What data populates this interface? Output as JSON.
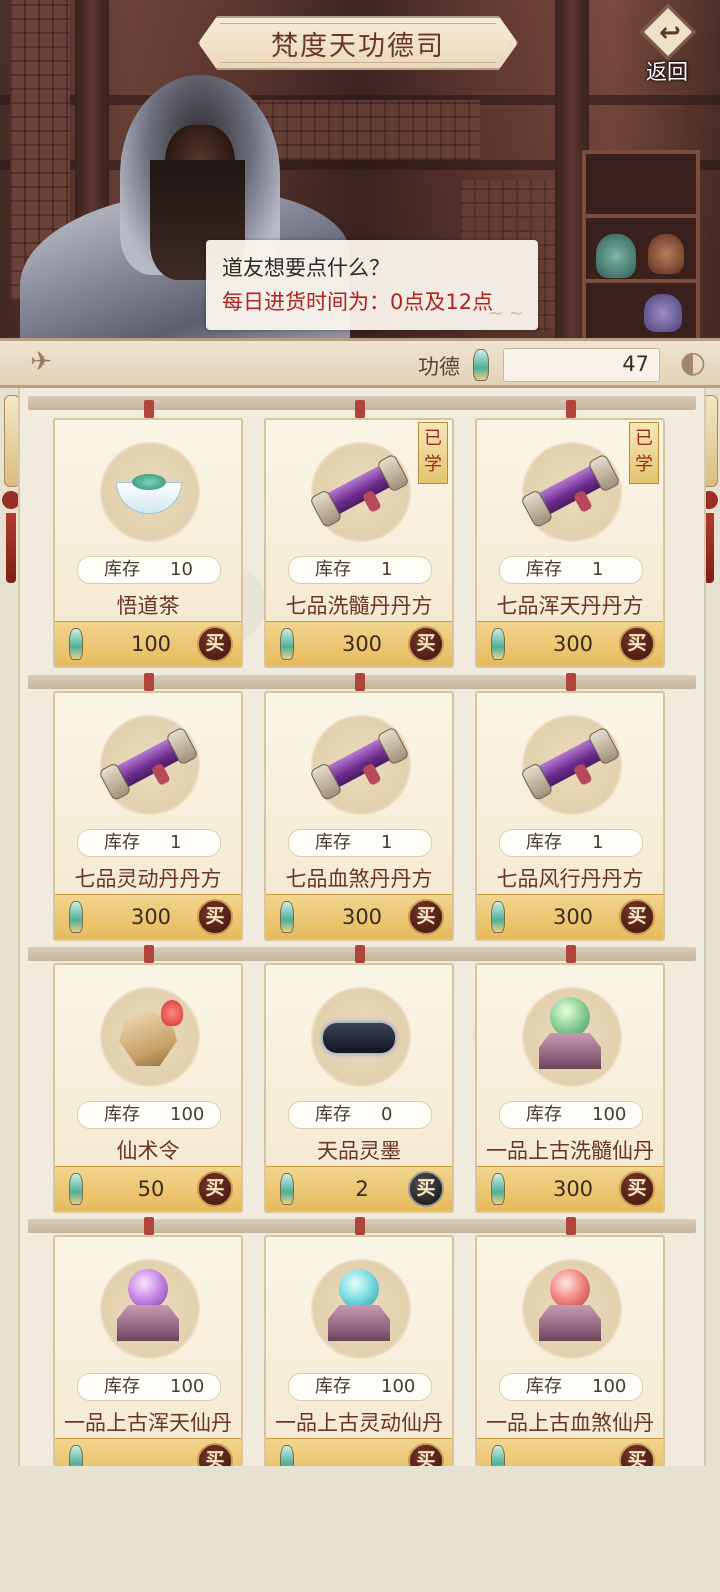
{
  "header": {
    "title": "梵度天功德司",
    "back_label": "返回"
  },
  "dialog": {
    "line1": "道友想要点什么？",
    "line2": "每日进货时间为：0点及12点"
  },
  "merit": {
    "label": "功德",
    "value": "47"
  },
  "shop": {
    "stock_label": "库存",
    "buy_label": "买",
    "learned_label": "已学",
    "items": [
      {
        "name": "悟道茶",
        "stock": "10",
        "price": "100",
        "learned": false,
        "art": "tea"
      },
      {
        "name": "七品洗髓丹丹方",
        "stock": "1",
        "price": "300",
        "learned": true,
        "art": "scroll"
      },
      {
        "name": "七品浑天丹丹方",
        "stock": "1",
        "price": "300",
        "learned": true,
        "art": "scroll"
      },
      {
        "name": "七品灵动丹丹方",
        "stock": "1",
        "price": "300",
        "learned": false,
        "art": "scroll"
      },
      {
        "name": "七品血煞丹丹方",
        "stock": "1",
        "price": "300",
        "learned": false,
        "art": "scroll"
      },
      {
        "name": "七品风行丹丹方",
        "stock": "1",
        "price": "300",
        "learned": false,
        "art": "scroll"
      },
      {
        "name": "仙术令",
        "stock": "100",
        "price": "50",
        "learned": false,
        "art": "token"
      },
      {
        "name": "天品灵墨",
        "stock": "0",
        "price": "2",
        "learned": false,
        "art": "ink"
      },
      {
        "name": "一品上古洗髓仙丹",
        "stock": "100",
        "price": "300",
        "learned": false,
        "art": "pill-green"
      },
      {
        "name": "一品上古浑天仙丹",
        "stock": "100",
        "price": "",
        "learned": false,
        "art": "pill-purple"
      },
      {
        "name": "一品上古灵动仙丹",
        "stock": "100",
        "price": "",
        "learned": false,
        "art": "pill-cyan"
      },
      {
        "name": "一品上古血煞仙丹",
        "stock": "100",
        "price": "",
        "learned": false,
        "art": "pill-red"
      }
    ]
  },
  "colors": {
    "title_text": "#6b3526",
    "dialog_red": "#b2221e",
    "price_bar": "#e6bb5c",
    "buy_button": "#4e1d14"
  },
  "icons": {
    "back": "return-arrow-icon",
    "merit": "jade-merit-icon",
    "crane": "crane-icon"
  }
}
